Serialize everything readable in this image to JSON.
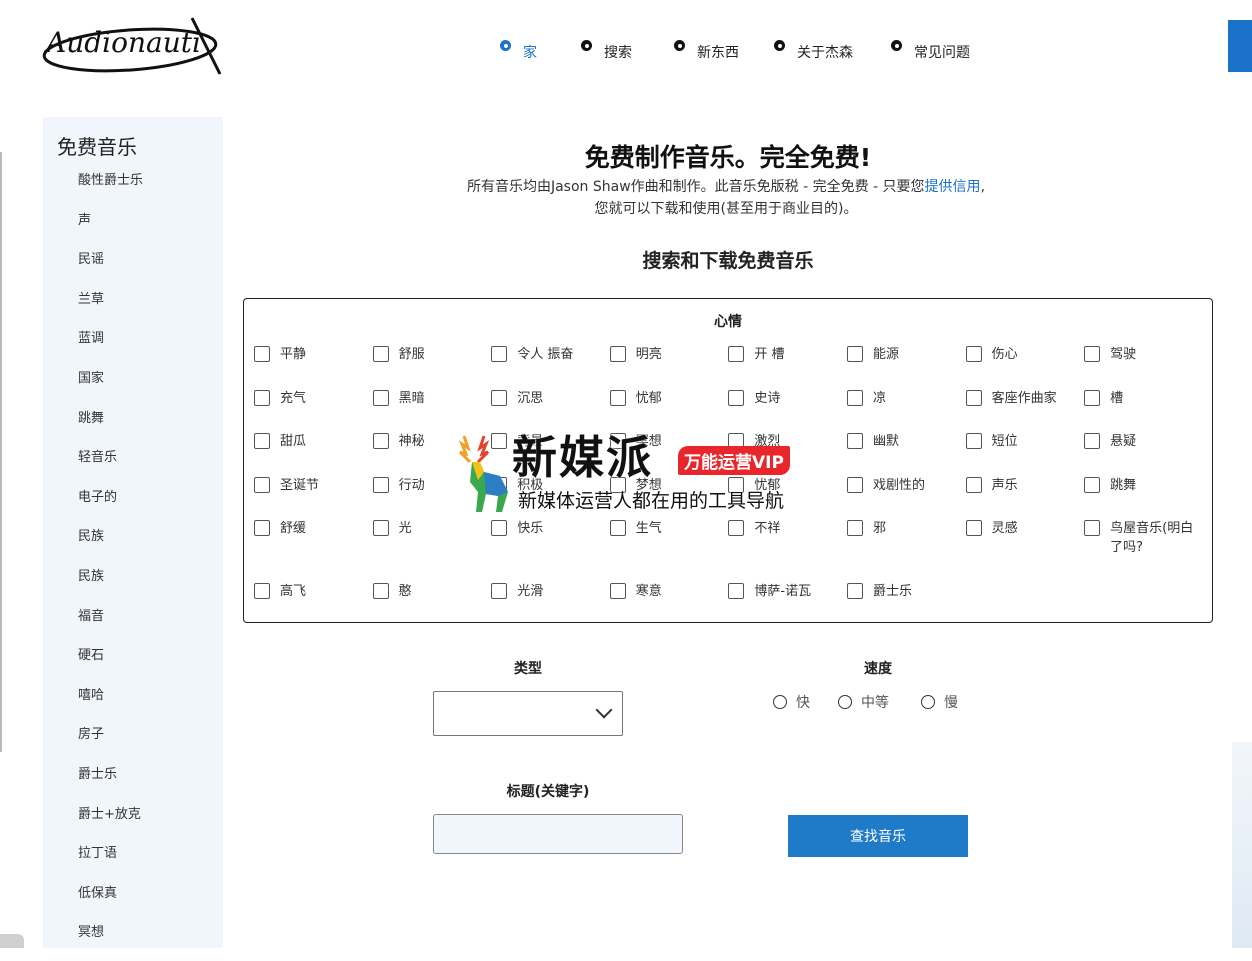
{
  "logo": {
    "text": "Audionautix"
  },
  "nav": {
    "items": [
      {
        "label": "家",
        "active": true
      },
      {
        "label": "搜索",
        "active": false
      },
      {
        "label": "新东西",
        "active": false
      },
      {
        "label": "关于杰森",
        "active": false
      },
      {
        "label": "常见问题",
        "active": false
      }
    ]
  },
  "sidebar": {
    "title": "免费音乐",
    "items": [
      "酸性爵士乐",
      "声",
      "民谣",
      "兰草",
      "蓝调",
      "国家",
      "跳舞",
      "轻音乐",
      "电子的",
      "民族",
      "民族",
      "福音",
      "硬石",
      "嘻哈",
      "房子",
      "爵士乐",
      "爵士+放克",
      "拉丁语",
      "低保真",
      "冥想"
    ]
  },
  "main": {
    "title": "免费制作音乐。完全免费!",
    "intro_before": "所有音乐均由Jason Shaw作曲和制作。此音乐免版税 - 完全免费 - 只要您",
    "intro_link": "提供信用",
    "intro_after": ",您就可以下载和使用(甚至用于商业目的)。",
    "section_title": "搜索和下载免费音乐"
  },
  "mood": {
    "title": "心情",
    "items": [
      "平静",
      "舒服",
      "令人 振奋",
      "明亮",
      "开 槽",
      "能源",
      "伤心",
      "驾驶",
      "充气",
      "黑暗",
      "沉思",
      "忧郁",
      "史诗",
      "凉",
      "客座作曲家",
      "槽",
      "甜瓜",
      "神秘",
      "背景",
      "冥想",
      "激烈",
      "幽默",
      "短位",
      "悬疑",
      "圣诞节",
      "行动",
      "积极",
      "梦想",
      "忧郁",
      "戏剧性的",
      "声乐",
      "跳舞",
      "舒缓",
      "光",
      "快乐",
      "生气",
      "不祥",
      "邪",
      "灵感",
      "鸟屋音乐(明白了吗?",
      "高飞",
      "憨",
      "光滑",
      "寒意",
      "博萨-诺瓦",
      "爵士乐"
    ]
  },
  "filters": {
    "type_label": "类型",
    "type_value": "",
    "speed_label": "速度",
    "speed_options": [
      "快",
      "中等",
      "慢"
    ],
    "keyword_label": "标题(关键字)",
    "keyword_value": "",
    "find_button": "查找音乐"
  },
  "watermark": {
    "main": "新媒派",
    "badge": "万能运营VIP",
    "sub": "新媒体运营人都在用的工具导航"
  },
  "colors": {
    "accent": "#1a73c9",
    "button": "#1f7bc8",
    "sidebar_bg": "#f1f6fc"
  }
}
